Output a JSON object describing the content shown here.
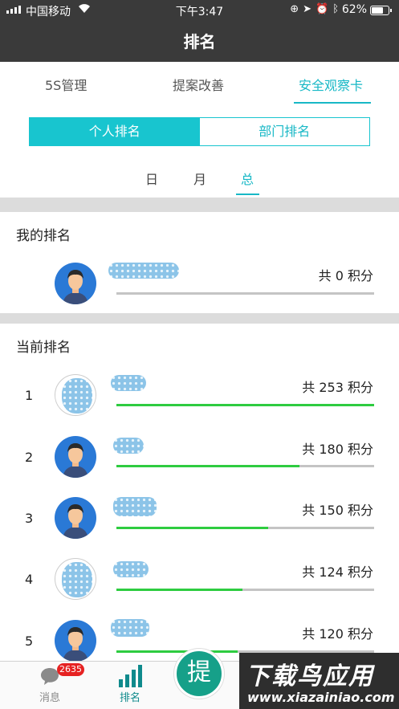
{
  "status_bar": {
    "carrier": "中国移动",
    "time": "下午3:47",
    "battery": "62%"
  },
  "header": {
    "title": "排名"
  },
  "top_tabs": [
    "5S管理",
    "提案改善",
    "安全观察卡"
  ],
  "segment": [
    "个人排名",
    "部门排名"
  ],
  "period_tabs": [
    "日",
    "月",
    "总"
  ],
  "my_rank": {
    "title": "我的排名",
    "score": "共 0 积分",
    "progress": 0
  },
  "current_rank": {
    "title": "当前排名",
    "rows": [
      {
        "rank": "1",
        "score": "共 253 积分",
        "progress": 1.0
      },
      {
        "rank": "2",
        "score": "共 180 积分",
        "progress": 0.71
      },
      {
        "rank": "3",
        "score": "共 150 积分",
        "progress": 0.59
      },
      {
        "rank": "4",
        "score": "共 124 积分",
        "progress": 0.49
      },
      {
        "rank": "5",
        "score": "共 120 积分",
        "progress": 0.47
      }
    ]
  },
  "bottom_nav": {
    "messages_label": "消息",
    "messages_badge": "2635",
    "ranking_label": "排名",
    "fab_label": "提"
  },
  "watermark": {
    "title": "下载鸟应用",
    "url": "www.xiazainiao.com"
  },
  "colors": {
    "accent": "#18b8c6",
    "progress": "#2ecc40",
    "header": "#3a3a3a",
    "fab": "#16a089"
  }
}
